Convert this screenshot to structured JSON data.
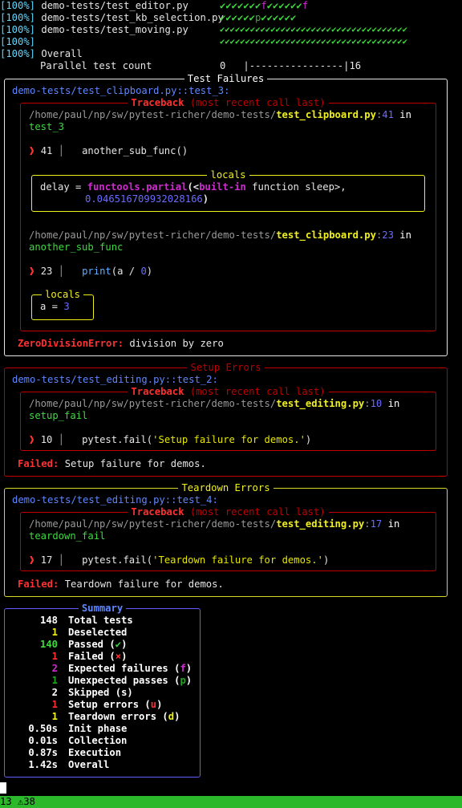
{
  "progress": [
    {
      "pct": "[100%]",
      "file": "demo-tests/test_editor.py",
      "marks": "✔✔✔✔✔✔✔f✔✔✔✔✔✔f"
    },
    {
      "pct": "[100%]",
      "file": "demo-tests/test_kb_selection.py",
      "marks": "✔✔✔✔✔✔p✔✔✔✔✔✔"
    },
    {
      "pct": "[100%]",
      "file": "demo-tests/test_moving.py",
      "marks": "✔✔✔✔✔✔✔✔✔✔✔✔✔✔✔✔✔✔✔✔✔✔✔✔✔✔✔✔✔✔✔✔✔✔✔✔✔"
    },
    {
      "pct": "[100%]",
      "file": "",
      "marks": "✔✔✔✔✔✔✔✔✔✔✔✔✔✔✔✔✔✔✔✔✔✔✔✔✔✔✔✔✔✔✔✔✔✔✔✔✔"
    }
  ],
  "overall": {
    "pct": "[100%]",
    "label": "Overall"
  },
  "parallel": {
    "label": "Parallel test count",
    "min": "0",
    "bar": "|----------------|",
    "max": "16"
  },
  "test_failures": {
    "title": "Test Failures",
    "test_id": "demo-tests/test_clipboard.py::test_3:",
    "traceback_title": "Traceback",
    "traceback_note": "(most recent call last)",
    "frame1": {
      "dir": "/home/paul/np/sw/pytest-richer/demo-tests/",
      "file": "test_clipboard.py",
      "colon": ":",
      "line": "41",
      "in": " in",
      "func": "test_3",
      "marker": "❱",
      "lineno": "41",
      "code": "another_sub_func()"
    },
    "locals1": {
      "title": "locals",
      "var": "delay",
      "eq": " = ",
      "call": "functools.partial",
      "open": "(<",
      "builtin": "built-in",
      "rest": " function sleep>,",
      "value": "0.046516709932028166",
      "close": ")"
    },
    "frame2": {
      "dir": "/home/paul/np/sw/pytest-richer/demo-tests/",
      "file": "test_clipboard.py",
      "colon": ":",
      "line": "23",
      "in": " in",
      "func": "another_sub_func",
      "marker": "❱",
      "lineno": "23",
      "code_fn": "print",
      "code_open": "(a / ",
      "code_num": "0",
      "code_close": ")"
    },
    "locals2": {
      "title": "locals",
      "var": "a",
      "eq": " = ",
      "value": "3"
    },
    "error_type": "ZeroDivisionError:",
    "error_msg": " division by zero"
  },
  "setup_errors": {
    "title": "Setup Errors",
    "test_id": "demo-tests/test_editing.py::test_2:",
    "traceback_title": "Traceback",
    "traceback_note": "(most recent call last)",
    "frame": {
      "dir": "/home/paul/np/sw/pytest-richer/demo-tests/",
      "file": "test_editing.py",
      "colon": ":",
      "line": "10",
      "in": " in",
      "func": "setup_fail",
      "marker": "❱",
      "lineno": "10",
      "code_pre": "pytest.fail(",
      "code_str": "'Setup failure for demos.'",
      "code_post": ")"
    },
    "error_type": "Failed:",
    "error_msg": " Setup failure for demos."
  },
  "teardown_errors": {
    "title": "Teardown Errors",
    "test_id": "demo-tests/test_editing.py::test_4:",
    "traceback_title": "Traceback",
    "traceback_note": "(most recent call last)",
    "frame": {
      "dir": "/home/paul/np/sw/pytest-richer/demo-tests/",
      "file": "test_editing.py",
      "colon": ":",
      "line": "17",
      "in": " in",
      "func": "teardown_fail",
      "marker": "❱",
      "lineno": "17",
      "code_pre": "pytest.fail(",
      "code_str": "'Teardown failure for demos.'",
      "code_post": ")"
    },
    "error_type": "Failed:",
    "error_msg": " Teardown failure for demos."
  },
  "summary": {
    "title": "Summary",
    "rows": [
      {
        "value": "148",
        "label": "Total tests",
        "sym": "",
        "open": "",
        "close": ""
      },
      {
        "value": "1",
        "label": "Deselected",
        "sym": "",
        "open": "",
        "close": ""
      },
      {
        "value": "140",
        "label": "Passed",
        "sym": "✔",
        "open": " (",
        "close": ")"
      },
      {
        "value": "1",
        "label": "Failed",
        "sym": "×",
        "open": " (",
        "close": ")"
      },
      {
        "value": "2",
        "label": "Expected failures",
        "sym": "f",
        "open": " (",
        "close": ")"
      },
      {
        "value": "1",
        "label": "Unexpected passes",
        "sym": "p",
        "open": " (",
        "close": ")"
      },
      {
        "value": "2",
        "label": "Skipped",
        "sym": "s",
        "open": " (",
        "close": ")"
      },
      {
        "value": "1",
        "label": "Setup errors",
        "sym": "u",
        "open": " (",
        "close": ")"
      },
      {
        "value": "1",
        "label": "Teardown errors",
        "sym": "d",
        "open": " (",
        "close": ")"
      },
      {
        "value": "0.50s",
        "label": "Init phase",
        "sym": "",
        "open": "",
        "close": ""
      },
      {
        "value": "0.01s",
        "label": "Collection",
        "sym": "",
        "open": "",
        "close": ""
      },
      {
        "value": "0.87s",
        "label": "Execution",
        "sym": "",
        "open": "",
        "close": ""
      },
      {
        "value": "1.42s",
        "label": "Overall",
        "sym": "",
        "open": "",
        "close": ""
      }
    ]
  },
  "statusbar": {
    "text": "13 ⚠38"
  },
  "colors": {
    "pass": "#3fd93f",
    "fail": "#ff3030",
    "xfail": "#d02bd0",
    "warn": "#f0f01e",
    "path": "#5fd7ff",
    "status": "#2bb82b"
  }
}
